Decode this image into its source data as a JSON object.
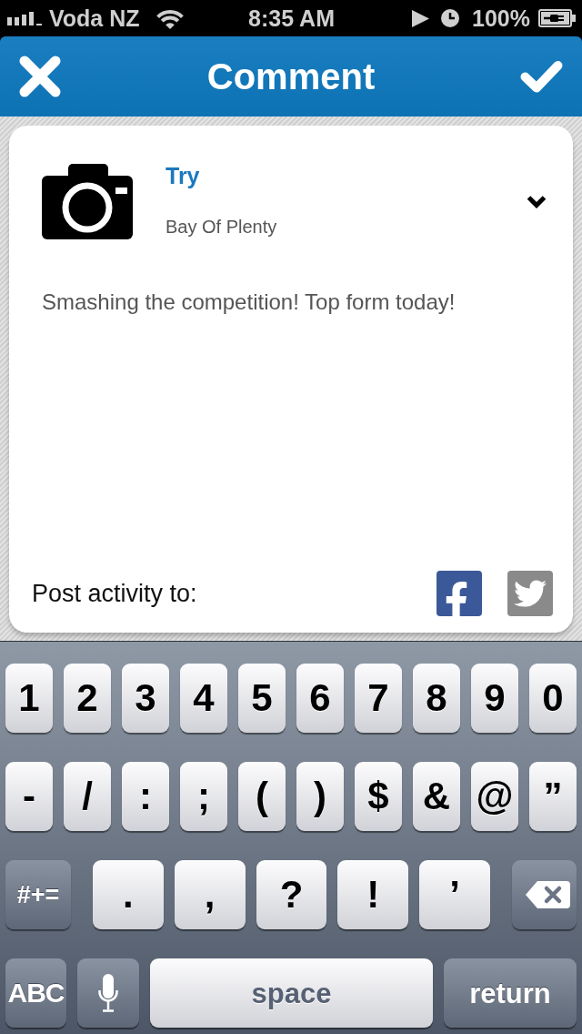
{
  "status_bar": {
    "carrier": "Voda NZ",
    "time": "8:35 AM",
    "battery": "100%"
  },
  "nav_bar": {
    "title": "Comment"
  },
  "post": {
    "title": "Try",
    "subtitle": "Bay Of Plenty",
    "comment": "Smashing the competition! Top form today!"
  },
  "share": {
    "label": "Post activity to:",
    "targets": [
      {
        "kind": "facebook",
        "on": true
      },
      {
        "kind": "twitter",
        "on": false
      }
    ]
  },
  "keyboard": {
    "rows": [
      {
        "keys": [
          {
            "kind": "char",
            "label": "1"
          },
          {
            "kind": "char",
            "label": "2"
          },
          {
            "kind": "char",
            "label": "3"
          },
          {
            "kind": "char",
            "label": "4"
          },
          {
            "kind": "char",
            "label": "5"
          },
          {
            "kind": "char",
            "label": "6"
          },
          {
            "kind": "char",
            "label": "7"
          },
          {
            "kind": "char",
            "label": "8"
          },
          {
            "kind": "char",
            "label": "9"
          },
          {
            "kind": "char",
            "label": "0"
          }
        ]
      },
      {
        "keys": [
          {
            "kind": "char",
            "label": "-"
          },
          {
            "kind": "char",
            "label": "/"
          },
          {
            "kind": "char",
            "label": ":"
          },
          {
            "kind": "char",
            "label": ";"
          },
          {
            "kind": "char",
            "label": "("
          },
          {
            "kind": "char",
            "label": ")"
          },
          {
            "kind": "char",
            "label": "$"
          },
          {
            "kind": "char",
            "label": "&"
          },
          {
            "kind": "char",
            "label": "@"
          },
          {
            "kind": "char",
            "label": "”"
          }
        ]
      },
      {
        "keys": [
          {
            "kind": "symbols",
            "label": "#+="
          },
          {
            "kind": "char",
            "label": "."
          },
          {
            "kind": "char",
            "label": ","
          },
          {
            "kind": "char",
            "label": "?"
          },
          {
            "kind": "char",
            "label": "!"
          },
          {
            "kind": "char",
            "label": "’"
          },
          {
            "kind": "delete"
          }
        ]
      },
      {
        "keys": [
          {
            "kind": "mode",
            "label": "ABC"
          },
          {
            "kind": "mic"
          },
          {
            "kind": "space",
            "label": "space"
          },
          {
            "kind": "return",
            "label": "return"
          }
        ]
      }
    ]
  }
}
